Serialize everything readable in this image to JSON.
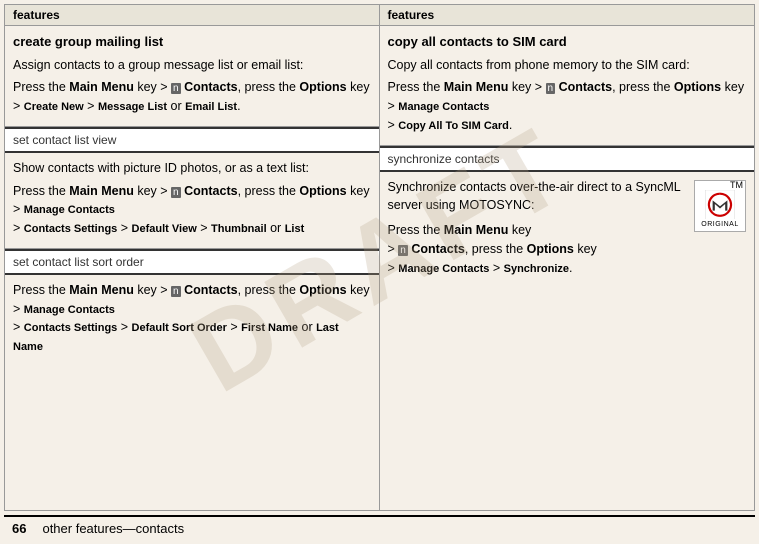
{
  "watermark": "DRAFT",
  "footer": {
    "page_number": "66",
    "text": "other features—contacts"
  },
  "columns": {
    "header_label": "features"
  },
  "left_col": {
    "sections": [
      {
        "id": "create-group",
        "title": "create group mailing list",
        "body_intro": "Assign contacts to a group message list or email list:",
        "instruction": "Press the",
        "main_menu_label": "Main Menu",
        "key_text": "key >",
        "contacts_label": "Contacts",
        "comma": ", press the",
        "options_label": "Options",
        "rest": "key >",
        "create_new": "Create New",
        "gt": ">",
        "message_list": "Message List",
        "or": "or",
        "email_list": "Email List",
        "full_instruction": "Press the Main Menu key > Contacts, press the Options key > Create New > Message List or Email List."
      },
      {
        "id": "set-contact-view",
        "title": "set contact list view",
        "body_intro": "Show contacts with picture ID photos, or as a text list:",
        "full_instruction": "Press the Main Menu key > Contacts, press the Options key > Manage Contacts > Contacts Settings > Default View > Thumbnail or List"
      },
      {
        "id": "set-contact-sort",
        "title": "set contact list sort order",
        "full_instruction": "Press the Main Menu key > Contacts, press the Options key > Manage Contacts > Contacts Settings > Default Sort Order > First Name or Last Name"
      }
    ]
  },
  "right_col": {
    "sections": [
      {
        "id": "copy-all-contacts",
        "title": "copy all contacts to SIM card",
        "body_intro": "Copy all contacts from phone memory to the SIM card:",
        "full_instruction": "Press the Main Menu key > Contacts, press the Options key > Manage Contacts > Copy All To SIM Card."
      },
      {
        "id": "sync-contacts",
        "title": "synchronize contacts",
        "body_intro": "Synchronize contacts over-the-air direct to a SyncML server using MOTOSYNC:",
        "full_instruction": "Press the Main Menu key > Contacts, press the Options key > Manage Contacts > Synchronize.",
        "moto_tm": "TM",
        "moto_original": "ORIGINAL"
      }
    ]
  }
}
